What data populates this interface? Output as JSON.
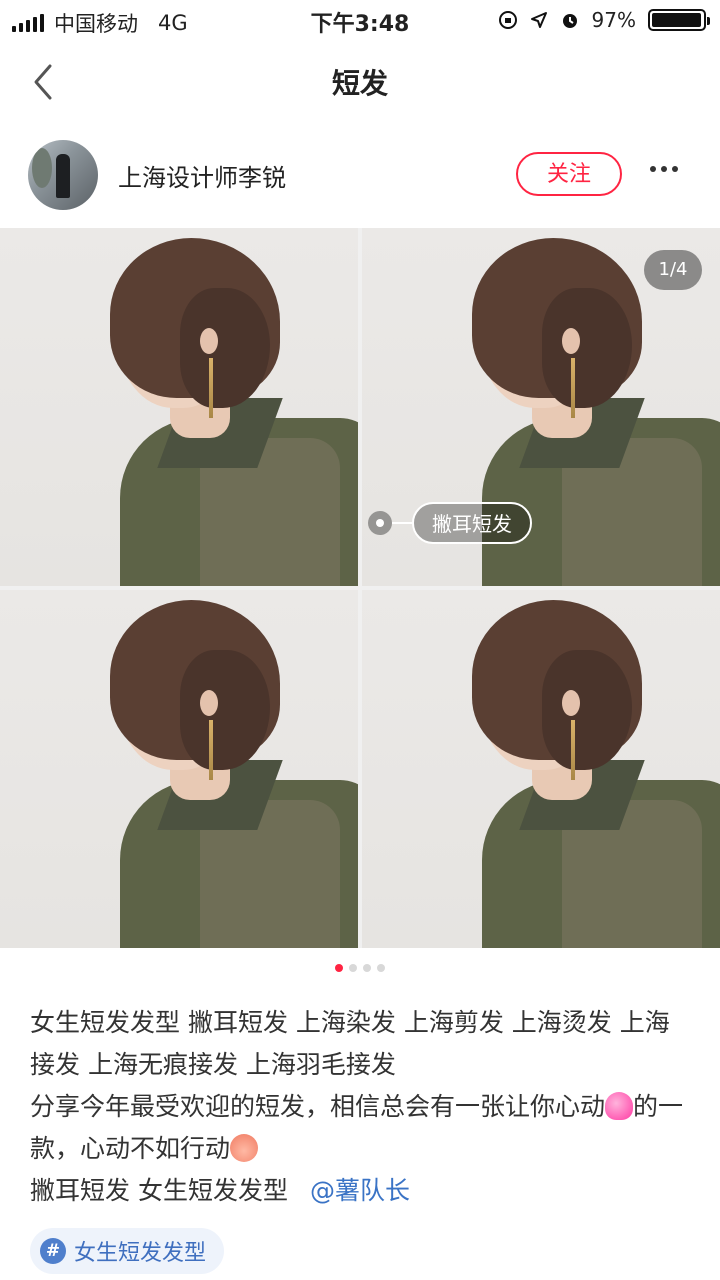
{
  "status_bar": {
    "carrier": "中国移动",
    "network": "4G",
    "time": "下午3:48",
    "battery": "97%",
    "battery_level": 0.97
  },
  "nav": {
    "title": "短发",
    "back_icon": "chevron-left-icon"
  },
  "author": {
    "name": "上海设计师李锐",
    "follow_label": "关注",
    "more_icon": "more-icon"
  },
  "gallery": {
    "counter": "1/4",
    "tag_label": "撇耳短发",
    "page_count": 4,
    "active_page": 1
  },
  "content": {
    "line1": "女生短发发型 撇耳短发 上海染发 上海剪发 上海烫发 上海接发 上海无痕接发 上海羽毛接发",
    "line2a": "分享今年最受欢迎的短发，相信总会有一张让你心动",
    "line2b": "的一款，心动不如行动",
    "line3": "撇耳短发 女生短发发型",
    "mention": "@薯队长"
  },
  "topic": {
    "hash": "#",
    "label": "女生短发发型"
  },
  "colors": {
    "accent": "#ff2442",
    "link": "#3a73c5"
  }
}
